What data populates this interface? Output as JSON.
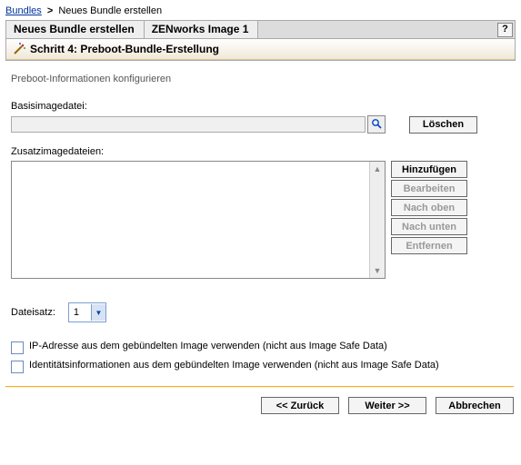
{
  "breadcrumb": {
    "root": "Bundles",
    "current": "Neues Bundle erstellen"
  },
  "tabs": {
    "tab1": "Neues Bundle erstellen",
    "tab2": "ZENworks Image 1"
  },
  "help": "?",
  "step_title": "Schritt 4: Preboot-Bundle-Erstellung",
  "subtitle": "Preboot-Informationen konfigurieren",
  "labels": {
    "base": "Basisimagedatei:",
    "add": "Zusatzimagedateien:",
    "fileset": "Dateisatz:"
  },
  "buttons": {
    "delete": "Löschen",
    "add": "Hinzufügen",
    "edit": "Bearbeiten",
    "up": "Nach oben",
    "down": "Nach unten",
    "remove": "Entfernen",
    "back": "<< Zurück",
    "next": "Weiter >>",
    "cancel": "Abbrechen"
  },
  "fileset_value": "1",
  "checks": {
    "ip": "IP-Adresse aus dem gebündelten Image verwenden (nicht aus Image Safe Data)",
    "identity": "Identitätsinformationen aus dem gebündelten Image verwenden (nicht aus Image Safe Data)"
  }
}
